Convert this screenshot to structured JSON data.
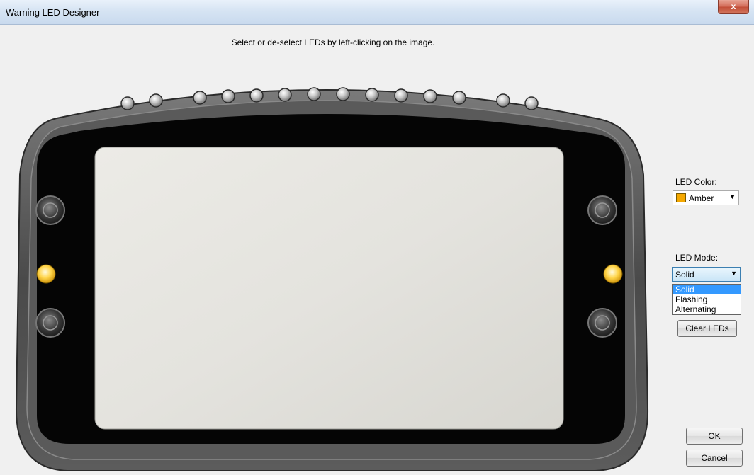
{
  "window": {
    "title": "Warning LED Designer",
    "close_label": "x"
  },
  "instruction": "Select or de-select LEDs by left-clicking on the image.",
  "led_color": {
    "label": "LED Color:",
    "value": "Amber",
    "swatch_color": "#f5a800"
  },
  "led_mode": {
    "label": "LED Mode:",
    "value": "Solid",
    "options": [
      "Solid",
      "Flashing",
      "Alternating"
    ],
    "selected_index": 0
  },
  "buttons": {
    "clear": "Clear LEDs",
    "ok": "OK",
    "cancel": "Cancel"
  },
  "device": {
    "top_leds": [
      {
        "lit": false
      },
      {
        "lit": false
      },
      {
        "lit": false
      },
      {
        "lit": false
      },
      {
        "lit": false
      },
      {
        "lit": false
      },
      {
        "lit": false
      },
      {
        "lit": false
      },
      {
        "lit": false
      },
      {
        "lit": false
      },
      {
        "lit": false
      },
      {
        "lit": false
      },
      {
        "lit": false
      },
      {
        "lit": false
      }
    ],
    "left_led_lit": true,
    "right_led_lit": true,
    "lit_color": "#ffc21a"
  }
}
